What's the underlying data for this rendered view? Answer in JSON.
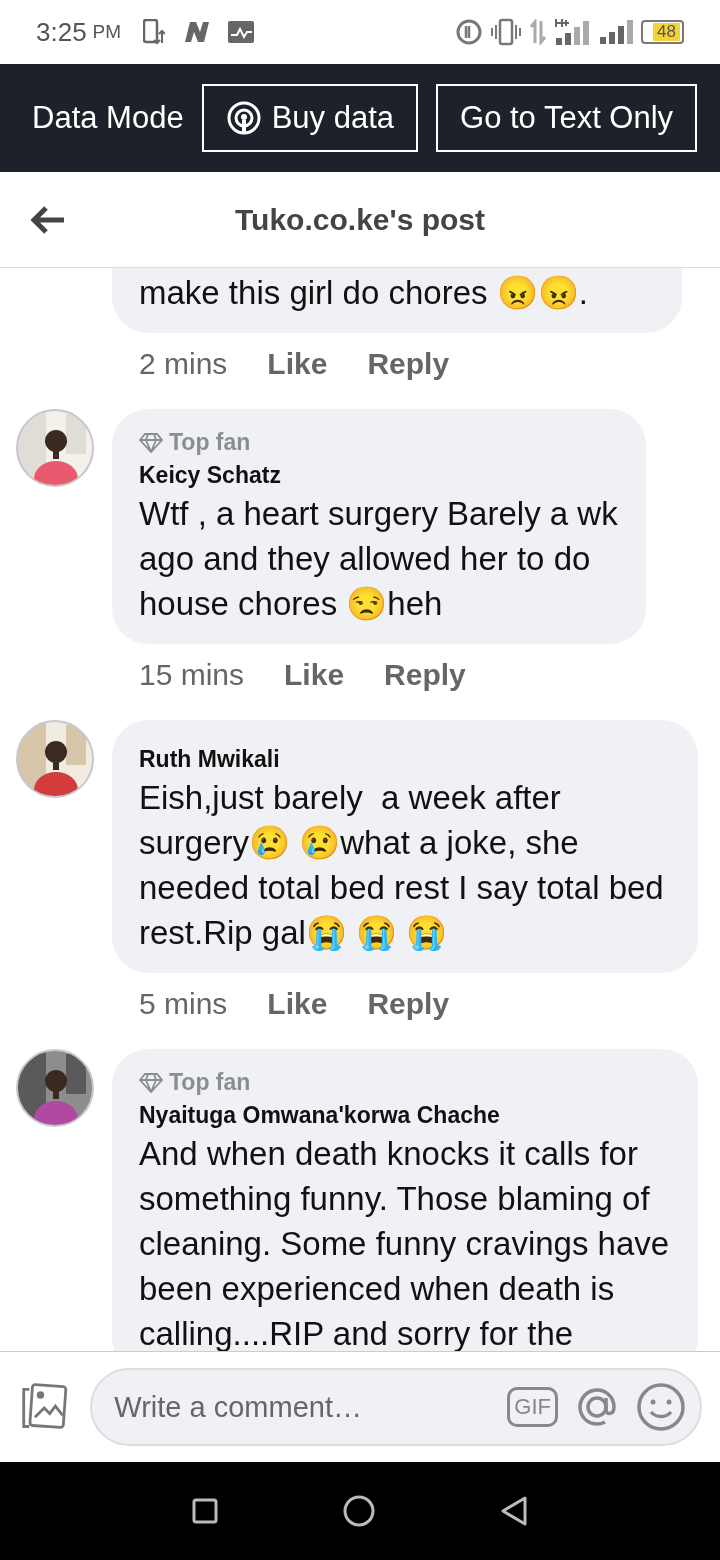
{
  "status_bar": {
    "time": "3:25",
    "period": "PM",
    "battery": "48"
  },
  "data_bar": {
    "label": "Data Mode",
    "buttons": [
      {
        "label": "Buy data",
        "kind": "icon"
      },
      {
        "label": "Go to Text Only",
        "kind": "plain"
      }
    ]
  },
  "header": {
    "title": "Tuko.co.ke's post"
  },
  "comments": [
    {
      "body": "make this girl do chores 😠😠.",
      "time": "2 mins",
      "actions": [
        "Like",
        "Reply"
      ]
    },
    {
      "badge": "Top fan",
      "author": "Keicy Schatz",
      "body": "Wtf , a heart surgery Barely a wk ago and they allowed her to do house chores 😒heh",
      "time": "15 mins",
      "actions": [
        "Like",
        "Reply"
      ]
    },
    {
      "author": "Ruth Mwikali",
      "body": "Eish,just barely  a week after surgery😢 😢what a joke, she needed total bed rest I say total bed rest.Rip gal😭 😭 😭",
      "time": "5 mins",
      "actions": [
        "Like",
        "Reply"
      ]
    },
    {
      "badge": "Top fan",
      "author": "Nyaituga Omwana'korwa Chache",
      "body": "And when death knocks it calls for something funny. Those blaming of cleaning. Some funny cravings have been experienced when death is calling....RIP and sorry for the"
    }
  ],
  "composer": {
    "placeholder": "Write a comment…",
    "gif": "GIF"
  }
}
